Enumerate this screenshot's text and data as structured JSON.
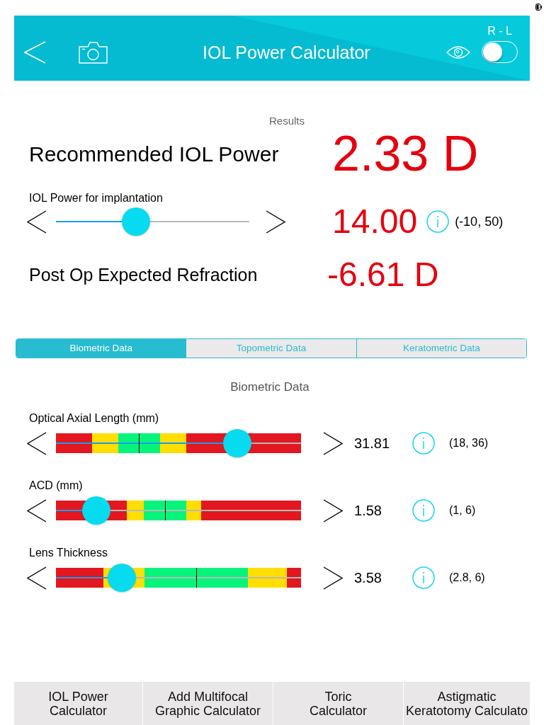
{
  "header": {
    "title": "IOL Power Calculator",
    "toggle_label": "R - L",
    "toggle": {
      "on": false
    }
  },
  "results": {
    "heading": "Results",
    "recommended": {
      "label": "Recommended IOL Power",
      "value": "2.33 D"
    },
    "implant": {
      "label": "IOL Power for implantation",
      "level": 0.4,
      "value": "14.00",
      "range": "(-10, 50)"
    },
    "refraction": {
      "label": "Post Op Expected Refraction",
      "value": "-6.61 D"
    }
  },
  "tabs": [
    {
      "label": "Biometric Data",
      "selected": true
    },
    {
      "label": "Topometric Data",
      "selected": false
    },
    {
      "label": "Keratometric Data",
      "selected": false
    }
  ],
  "biometric": {
    "heading": "Biometric Data",
    "rows": [
      {
        "label": "Optical Axial Length (mm)",
        "level": 0.77,
        "value": "31.81",
        "range": "(18, 36)",
        "zones": [
          {
            "color": "#e2171f",
            "center_tick": false
          },
          {
            "color": "#ffde00",
            "center_tick": false
          },
          {
            "color": "#06f47b",
            "center_tick": true
          },
          {
            "color": "#ffde00",
            "center_tick": false
          },
          {
            "color": "#e2171f",
            "center_tick": false
          }
        ]
      },
      {
        "label": "ACD (mm)",
        "level": 0.12,
        "value": "1.58",
        "range": "(1, 6)",
        "zones": [
          {
            "color": "#e2171f",
            "center_tick": false
          },
          {
            "color": "#ffde00",
            "center_tick": false
          },
          {
            "color": "#06f47b",
            "center_tick": true
          },
          {
            "color": "#ffde00",
            "center_tick": false
          },
          {
            "color": "#e2171f",
            "center_tick": false
          }
        ]
      },
      {
        "label": "Lens Thickness",
        "level": 0.24,
        "value": "3.58",
        "range": "(2.8, 6)",
        "zones": [
          {
            "color": "#e2171f",
            "center_tick": false
          },
          {
            "color": "#ffde00",
            "center_tick": false
          },
          {
            "color": "#06f47b",
            "center_tick": true
          },
          {
            "color": "#ffde00",
            "center_tick": false
          },
          {
            "color": "#e2171f",
            "center_tick": false
          }
        ]
      }
    ]
  },
  "bottom_bar": [
    {
      "label": "IOL Power\nCalculator"
    },
    {
      "label": "Add Multifocal\nGraphic Calculator"
    },
    {
      "label": "Toric\nCalculator"
    },
    {
      "label": "Astigmatic\nKeratotomy Calculato"
    }
  ]
}
